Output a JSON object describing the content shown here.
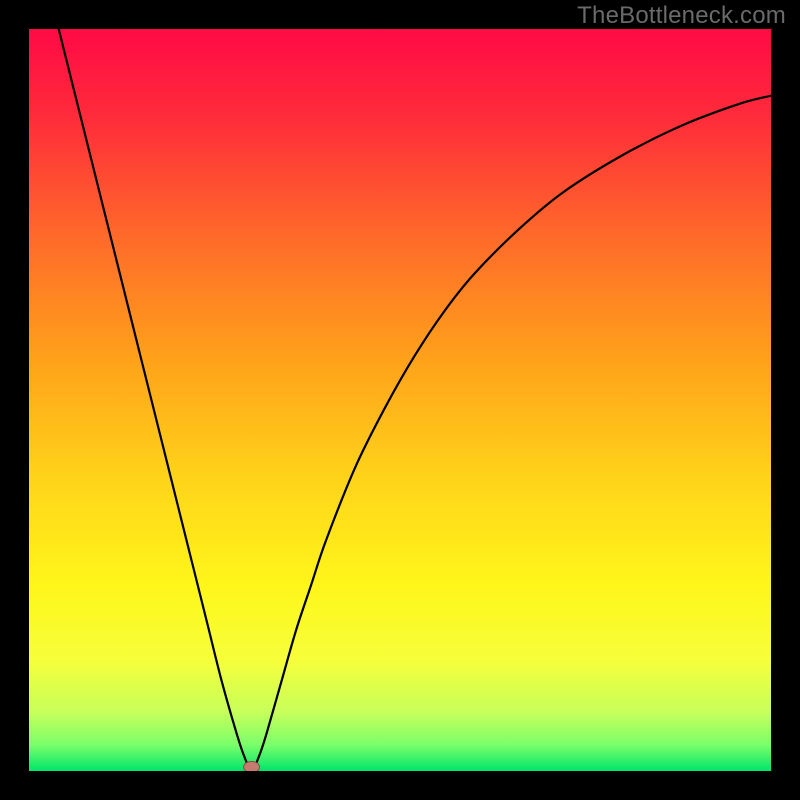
{
  "watermark": "TheBottleneck.com",
  "colors": {
    "frame_bg": "#000000",
    "curve_stroke": "#000000",
    "gradient_stops": [
      {
        "offset": 0.0,
        "color": "#ff0a46"
      },
      {
        "offset": 0.12,
        "color": "#ff2c3a"
      },
      {
        "offset": 0.28,
        "color": "#ff6a2a"
      },
      {
        "offset": 0.45,
        "color": "#ffa31a"
      },
      {
        "offset": 0.6,
        "color": "#ffd21a"
      },
      {
        "offset": 0.75,
        "color": "#fff61a"
      },
      {
        "offset": 0.85,
        "color": "#f6ff3a"
      },
      {
        "offset": 0.92,
        "color": "#c8ff5a"
      },
      {
        "offset": 0.965,
        "color": "#7aff6a"
      },
      {
        "offset": 1.0,
        "color": "#00e56a"
      }
    ],
    "marker_fill": "#c77a6f",
    "marker_stroke": "#8a4d44"
  },
  "chart_data": {
    "type": "line",
    "title": "",
    "xlabel": "",
    "ylabel": "",
    "xlim": [
      0,
      100
    ],
    "ylim": [
      0,
      100
    ],
    "grid": false,
    "legend": false,
    "series": [
      {
        "name": "bottleneck-curve",
        "x": [
          4,
          6,
          8,
          10,
          12,
          14,
          16,
          18,
          20,
          22,
          24,
          26,
          28,
          29,
          30,
          31,
          32,
          34,
          36,
          38,
          40,
          44,
          48,
          52,
          56,
          60,
          66,
          72,
          80,
          88,
          96,
          100
        ],
        "y": [
          100,
          92,
          84,
          76,
          68,
          60,
          52,
          44,
          36,
          28,
          20,
          12,
          5,
          2,
          0,
          2,
          5,
          12,
          19,
          25,
          31,
          41,
          49,
          56,
          62,
          67,
          73,
          78,
          83,
          87,
          90,
          91
        ]
      }
    ],
    "marker": {
      "x": 30,
      "y": 0
    }
  }
}
